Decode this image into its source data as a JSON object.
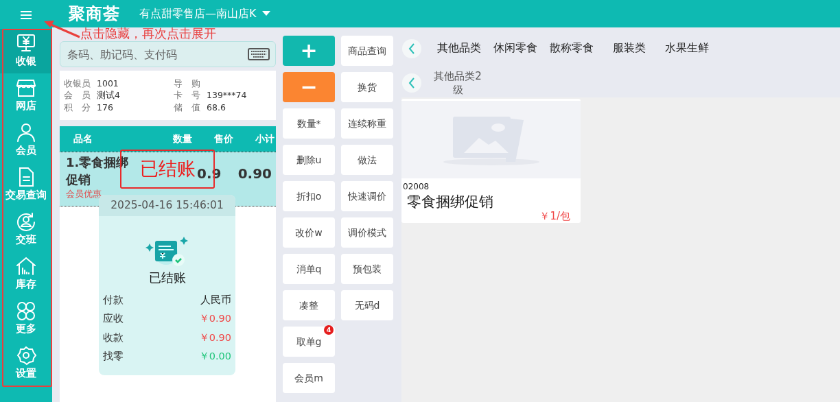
{
  "header": {
    "logo": "聚商荟",
    "store": "有点甜零售店—南山店K"
  },
  "sidebar": {
    "items": [
      {
        "label": "收银",
        "kind": "cashier",
        "selected": true
      },
      {
        "label": "网店",
        "kind": "store",
        "selected": false
      },
      {
        "label": "会员",
        "kind": "member",
        "selected": false
      },
      {
        "label": "交易查询",
        "kind": "document",
        "selected": false
      },
      {
        "label": "交班",
        "kind": "shift",
        "selected": false
      },
      {
        "label": "库存",
        "kind": "stock",
        "selected": false
      },
      {
        "label": "更多",
        "kind": "more",
        "selected": false
      },
      {
        "label": "设置",
        "kind": "settings",
        "selected": false
      }
    ]
  },
  "search": {
    "placeholder": "条码、助记码、支付码"
  },
  "info": [
    {
      "label": "收银员",
      "value": "1001"
    },
    {
      "label": "导　购"
    },
    {
      "label": "会　员",
      "value": "测试4"
    },
    {
      "label": "卡　号",
      "value": "139***74"
    },
    {
      "label": "积　分",
      "value": "176"
    },
    {
      "label": "储　值",
      "value": "68.6"
    }
  ],
  "table": {
    "columns": [
      "品名",
      "数量",
      "售价",
      "小计"
    ],
    "rows": [
      {
        "name": "1.零食捆绑促销",
        "tag": "会员优惠",
        "price": "0.9",
        "subtotal": "0.90",
        "selected": true
      }
    ]
  },
  "receipt": {
    "datetime": "2025-04-16 15:46:01",
    "status": "已结账",
    "lines": [
      {
        "label": "付款",
        "value": "人民币",
        "color": "#222222"
      },
      {
        "label": "应收",
        "value": "￥0.90",
        "color": "#f04848"
      },
      {
        "label": "收款",
        "value": "￥0.90",
        "color": "#f04848"
      },
      {
        "label": "找零",
        "value": "￥0.00",
        "color": "#1fc57a"
      }
    ]
  },
  "buttons": {
    "column_1": [
      {
        "kind": "add",
        "label": "+"
      },
      {
        "kind": "remove",
        "label": "−"
      },
      {
        "kind": "text",
        "label": "数量*"
      },
      {
        "kind": "text",
        "label": "删除u"
      },
      {
        "kind": "text",
        "label": "折扣o"
      },
      {
        "kind": "text",
        "label": "改价w"
      },
      {
        "kind": "text",
        "label": "消单q"
      },
      {
        "kind": "text",
        "label": "凑整"
      },
      {
        "kind": "text",
        "label": "取单g",
        "badge": "4"
      },
      {
        "kind": "text",
        "label": "会员m"
      }
    ],
    "column_2": [
      {
        "kind": "text",
        "label": "商品查询"
      },
      {
        "kind": "text",
        "label": "换货"
      },
      {
        "kind": "text",
        "label": "连续称重"
      },
      {
        "kind": "text",
        "label": "做法"
      },
      {
        "kind": "text",
        "label": "快速调价"
      },
      {
        "kind": "text",
        "label": "调价模式"
      },
      {
        "kind": "text",
        "label": "预包装"
      },
      {
        "kind": "text",
        "label": "无码d"
      }
    ]
  },
  "categories": [
    "其他品类",
    "休闲零食",
    "散称零食",
    "服装类",
    "水果生鲜"
  ],
  "subcategories": [
    "其他品类2级"
  ],
  "products": [
    {
      "code": "02008",
      "name": "零食捆绑促销",
      "price": "￥1/包"
    }
  ],
  "annotations": {
    "note": "点击隐藏，再次点击展开",
    "stamp": "已结账"
  }
}
